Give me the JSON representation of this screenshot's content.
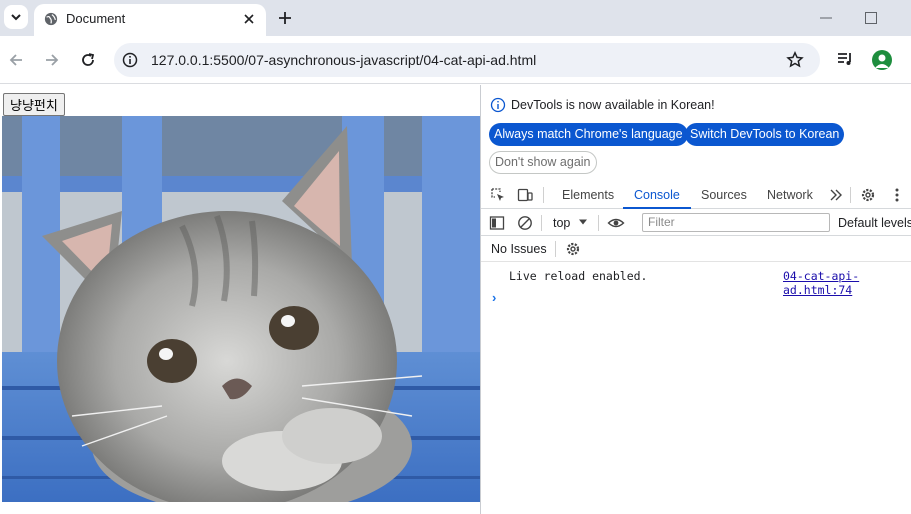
{
  "tabs": {
    "title": "Document"
  },
  "address": {
    "url": "127.0.0.1:5500/07-asynchronous-javascript/04-cat-api-ad.html"
  },
  "page": {
    "button_label": "냥냥펀치"
  },
  "devtools": {
    "banner": "DevTools is now available in Korean!",
    "match_language": "Always match Chrome's language",
    "switch_korean": "Switch DevTools to Korean",
    "dont_show": "Don't show again",
    "tabs": [
      "Elements",
      "Console",
      "Sources",
      "Network"
    ],
    "context": "top",
    "filter_placeholder": "Filter",
    "levels": "Default levels",
    "issues": "No Issues",
    "message": "Live reload enabled.",
    "message_source": "04-cat-api-ad.html:74",
    "prompt": "›"
  },
  "colors": {
    "accent": "#0b57d0",
    "tabbar": "#dfe3eb"
  },
  "icons": [
    "chevron-down-icon",
    "globe-icon",
    "close-icon",
    "plus-icon",
    "back-icon",
    "forward-icon",
    "reload-icon",
    "info-icon",
    "star-icon",
    "media-icon",
    "profile-icon",
    "inspect-icon",
    "device-icon",
    "more-tabs-icon",
    "settings-icon",
    "more-vert-icon",
    "sidebar-icon",
    "clear-icon",
    "eye-icon"
  ]
}
